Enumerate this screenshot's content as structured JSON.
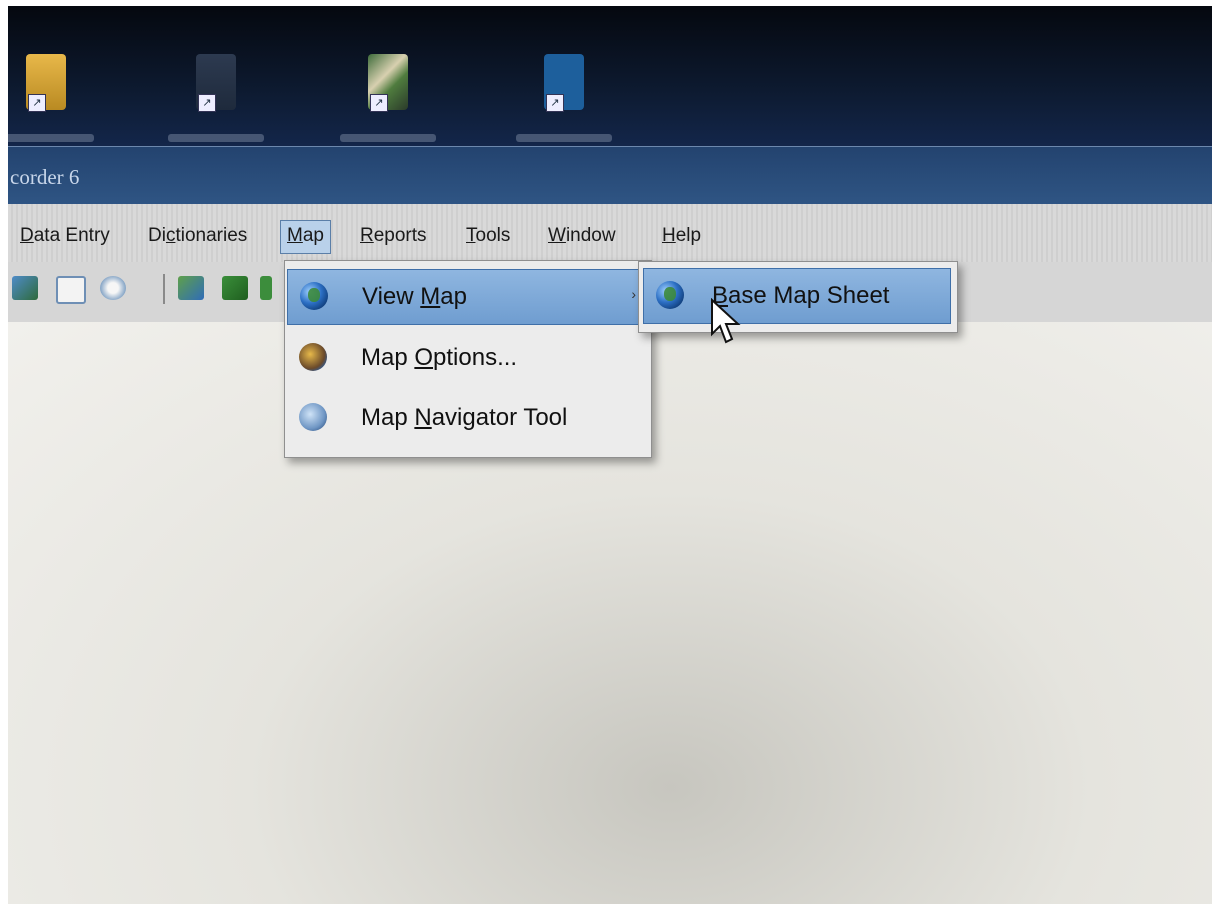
{
  "window": {
    "title": "corder 6"
  },
  "menubar": {
    "items": [
      {
        "label_pre": "",
        "label_u": "D",
        "label_post": "ata Entry"
      },
      {
        "label_pre": "Di",
        "label_u": "c",
        "label_post": "tionaries"
      },
      {
        "label_pre": "",
        "label_u": "M",
        "label_post": "ap"
      },
      {
        "label_pre": "",
        "label_u": "R",
        "label_post": "eports"
      },
      {
        "label_pre": "",
        "label_u": "T",
        "label_post": "ools"
      },
      {
        "label_pre": "",
        "label_u": "W",
        "label_post": "indow"
      },
      {
        "label_pre": "",
        "label_u": "H",
        "label_post": "elp"
      }
    ]
  },
  "map_menu": {
    "items": [
      {
        "label_pre": "View ",
        "label_u": "M",
        "label_post": "ap",
        "icon": "globe-icon",
        "has_submenu": true
      },
      {
        "label_pre": "Map ",
        "label_u": "O",
        "label_post": "ptions...",
        "icon": "map-options-icon"
      },
      {
        "label_pre": "Map ",
        "label_u": "N",
        "label_post": "avigator Tool",
        "icon": "navigator-icon"
      }
    ],
    "submenu_arrow": "›"
  },
  "submenu": {
    "items": [
      {
        "label_pre": "",
        "label_u": "B",
        "label_post": "ase Map Sheet",
        "icon": "globe-icon"
      }
    ]
  },
  "colors": {
    "menu_highlight": "#8fb6e0",
    "title_bar": "#2f5584"
  }
}
